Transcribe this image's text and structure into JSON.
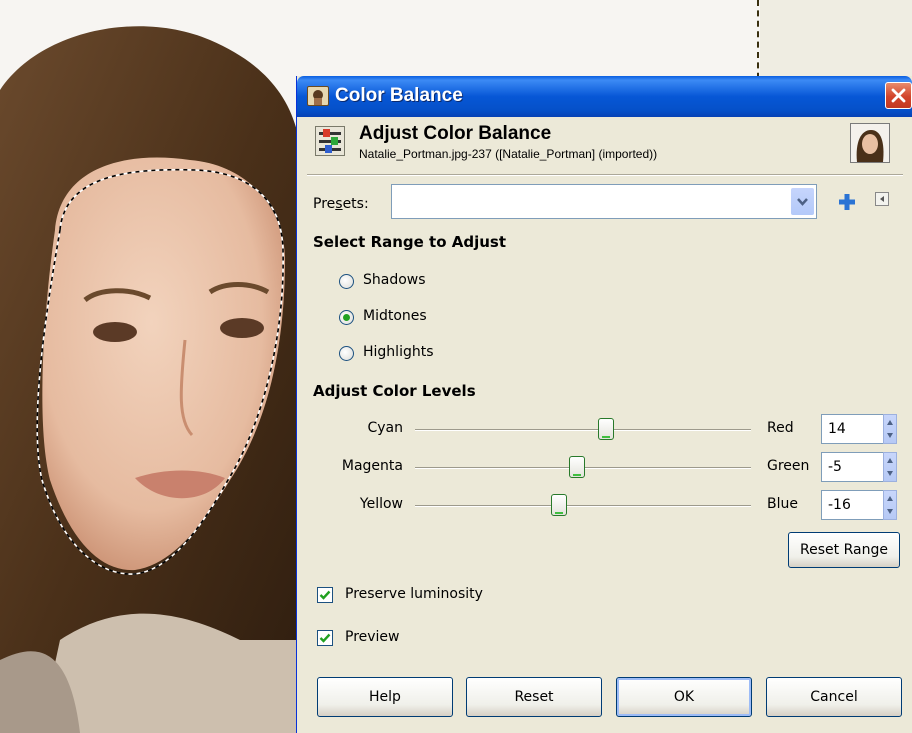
{
  "dialog": {
    "title": "Color Balance",
    "header_title": "Adjust Color Balance",
    "header_subtitle": "Natalie_Portman.jpg-237 ([Natalie_Portman] (imported))"
  },
  "presets": {
    "label": "Presets:",
    "value": ""
  },
  "range": {
    "section_title": "Select Range to Adjust",
    "options": [
      {
        "label": "Shadows",
        "selected": false
      },
      {
        "label": "Midtones",
        "selected": true
      },
      {
        "label": "Highlights",
        "selected": false
      }
    ]
  },
  "levels": {
    "section_title": "Adjust Color Levels",
    "sliders": [
      {
        "left": "Cyan",
        "right": "Red",
        "value": "14"
      },
      {
        "left": "Magenta",
        "right": "Green",
        "value": "-5"
      },
      {
        "left": "Yellow",
        "right": "Blue",
        "value": "-16"
      }
    ],
    "reset_range": "Reset Range"
  },
  "options": {
    "preserve_luminosity": {
      "label": "Preserve luminosity",
      "checked": true
    },
    "preview": {
      "label": "Preview",
      "checked": true
    }
  },
  "buttons": {
    "help": "Help",
    "reset": "Reset",
    "ok": "OK",
    "cancel": "Cancel"
  },
  "icons": {
    "app": "gimp-app-icon",
    "close": "close-icon",
    "tool": "color-balance-tool-icon",
    "thumbnail": "image-thumbnail",
    "add": "add-preset-icon",
    "menu": "preset-menu-icon"
  },
  "colors": {
    "titlebar": "#0757d6",
    "close_button": "#d2442b",
    "dialog_bg": "#ece9d8",
    "radio_dot": "#21a121"
  }
}
